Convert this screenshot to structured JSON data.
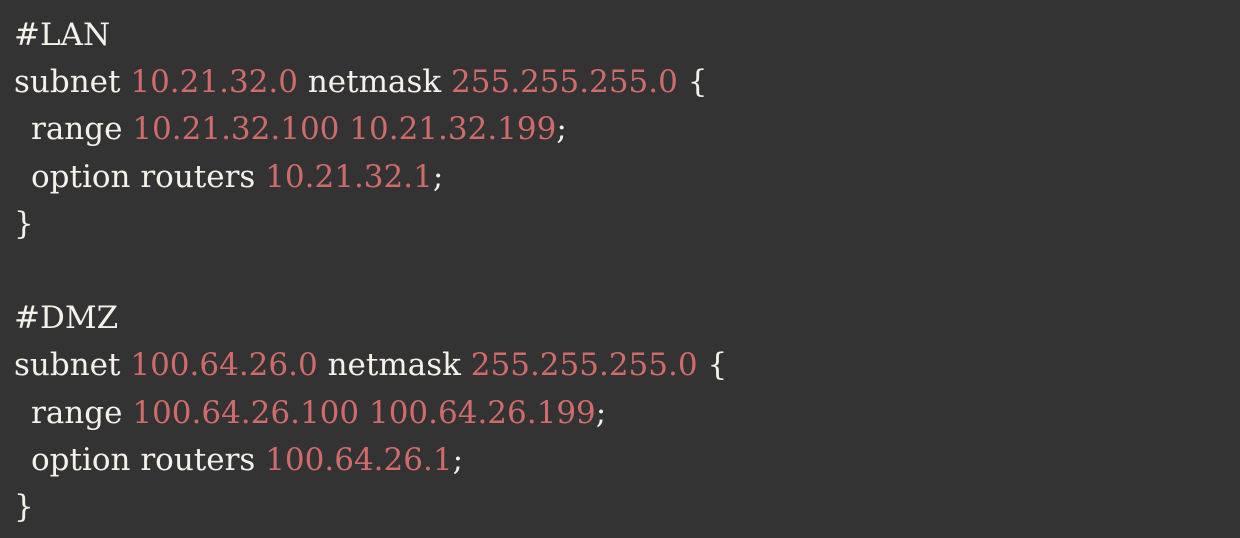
{
  "colors": {
    "background": "#333333",
    "text": "#f4f0ea",
    "value": "#d06b6b"
  },
  "config": {
    "lan": {
      "comment": "#LAN",
      "subnet_kw": "subnet",
      "subnet": "10.21.32.0",
      "netmask_kw": "netmask",
      "netmask": "255.255.255.0",
      "open_brace": "{",
      "range_kw": "range",
      "range_start": "10.21.32.100",
      "range_end": "10.21.32.199",
      "range_semicolon": ";",
      "routers_kw": "option routers",
      "router": "10.21.32.1",
      "routers_semicolon": ";",
      "close_brace": "}"
    },
    "dmz": {
      "comment": "#DMZ",
      "subnet_kw": "subnet",
      "subnet": "100.64.26.0",
      "netmask_kw": "netmask",
      "netmask": "255.255.255.0",
      "open_brace": "{",
      "range_kw": "range",
      "range_start": "100.64.26.100",
      "range_end": "100.64.26.199",
      "range_semicolon": ";",
      "routers_kw": "option routers",
      "router": "100.64.26.1",
      "routers_semicolon": ";",
      "close_brace": "}"
    }
  }
}
